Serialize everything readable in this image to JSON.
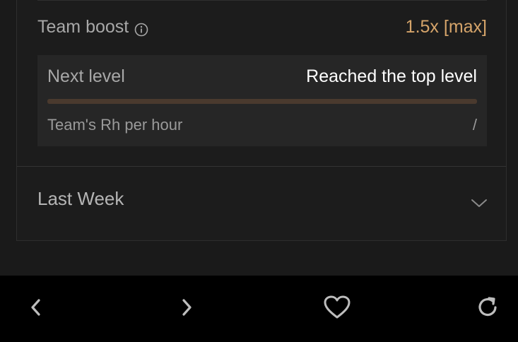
{
  "team_boost": {
    "label": "Team boost",
    "value": "1.5x [max]"
  },
  "level": {
    "next_label": "Next level",
    "next_value": "Reached the top level",
    "progress": 1.0,
    "rh_label": "Team's Rh per hour",
    "rh_value": "/"
  },
  "last_week": {
    "label": "Last Week"
  },
  "icons": {
    "info": "info-icon",
    "chevron": "chevron-down-icon",
    "back": "chevron-left-icon",
    "forward": "chevron-right-icon",
    "favorite": "heart-icon",
    "reload": "reload-icon"
  },
  "colors": {
    "accent": "#d5a46a",
    "background": "#1a1a1a",
    "panel": "#262626",
    "bar": "#000000"
  }
}
